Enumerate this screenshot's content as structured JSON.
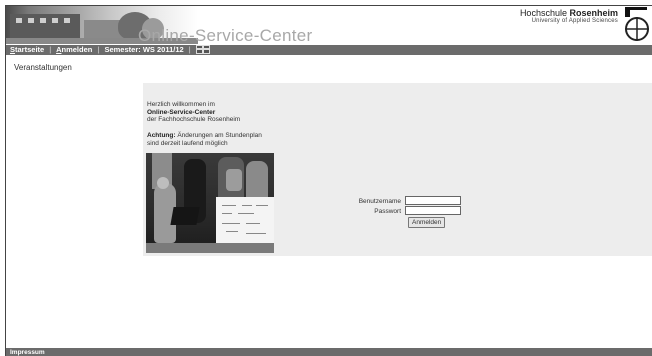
{
  "header": {
    "app_title": "Online-Service-Center",
    "univ_line1_regular": "Hochschule",
    "univ_line1_bold": "Rosenheim",
    "univ_line2": "University of Applied Sciences",
    "logo_icon": "university-logo-icon",
    "photo": "campus-building-photo"
  },
  "nav": {
    "startseite_first": "S",
    "startseite_rest": "tartseite",
    "anmelden_first": "A",
    "anmelden_rest": "nmelden",
    "semester_label": "Semester: WS 2011/12",
    "separator": "|",
    "language_icon": "uk-flag-icon"
  },
  "section_label": "Veranstaltungen",
  "welcome": {
    "line1": "Herzlich willkommen im",
    "line2": "Online-Service-Center",
    "line3": "der Fachhochschule Rosenheim"
  },
  "notice": {
    "label": "Achtung:",
    "line1_rest": "Änderungen am Stundenplan",
    "line2": "sind derzeit laufend möglich"
  },
  "login": {
    "username_label": "Benutzername",
    "username_value": "",
    "password_label": "Passwort",
    "password_value": "",
    "submit_label": "Anmelden"
  },
  "footer": {
    "impressum": "Impressum"
  },
  "colors": {
    "nav_bg": "#6b6b6b",
    "panel_bg": "#ededed",
    "title_gray": "#a8a8a8"
  }
}
